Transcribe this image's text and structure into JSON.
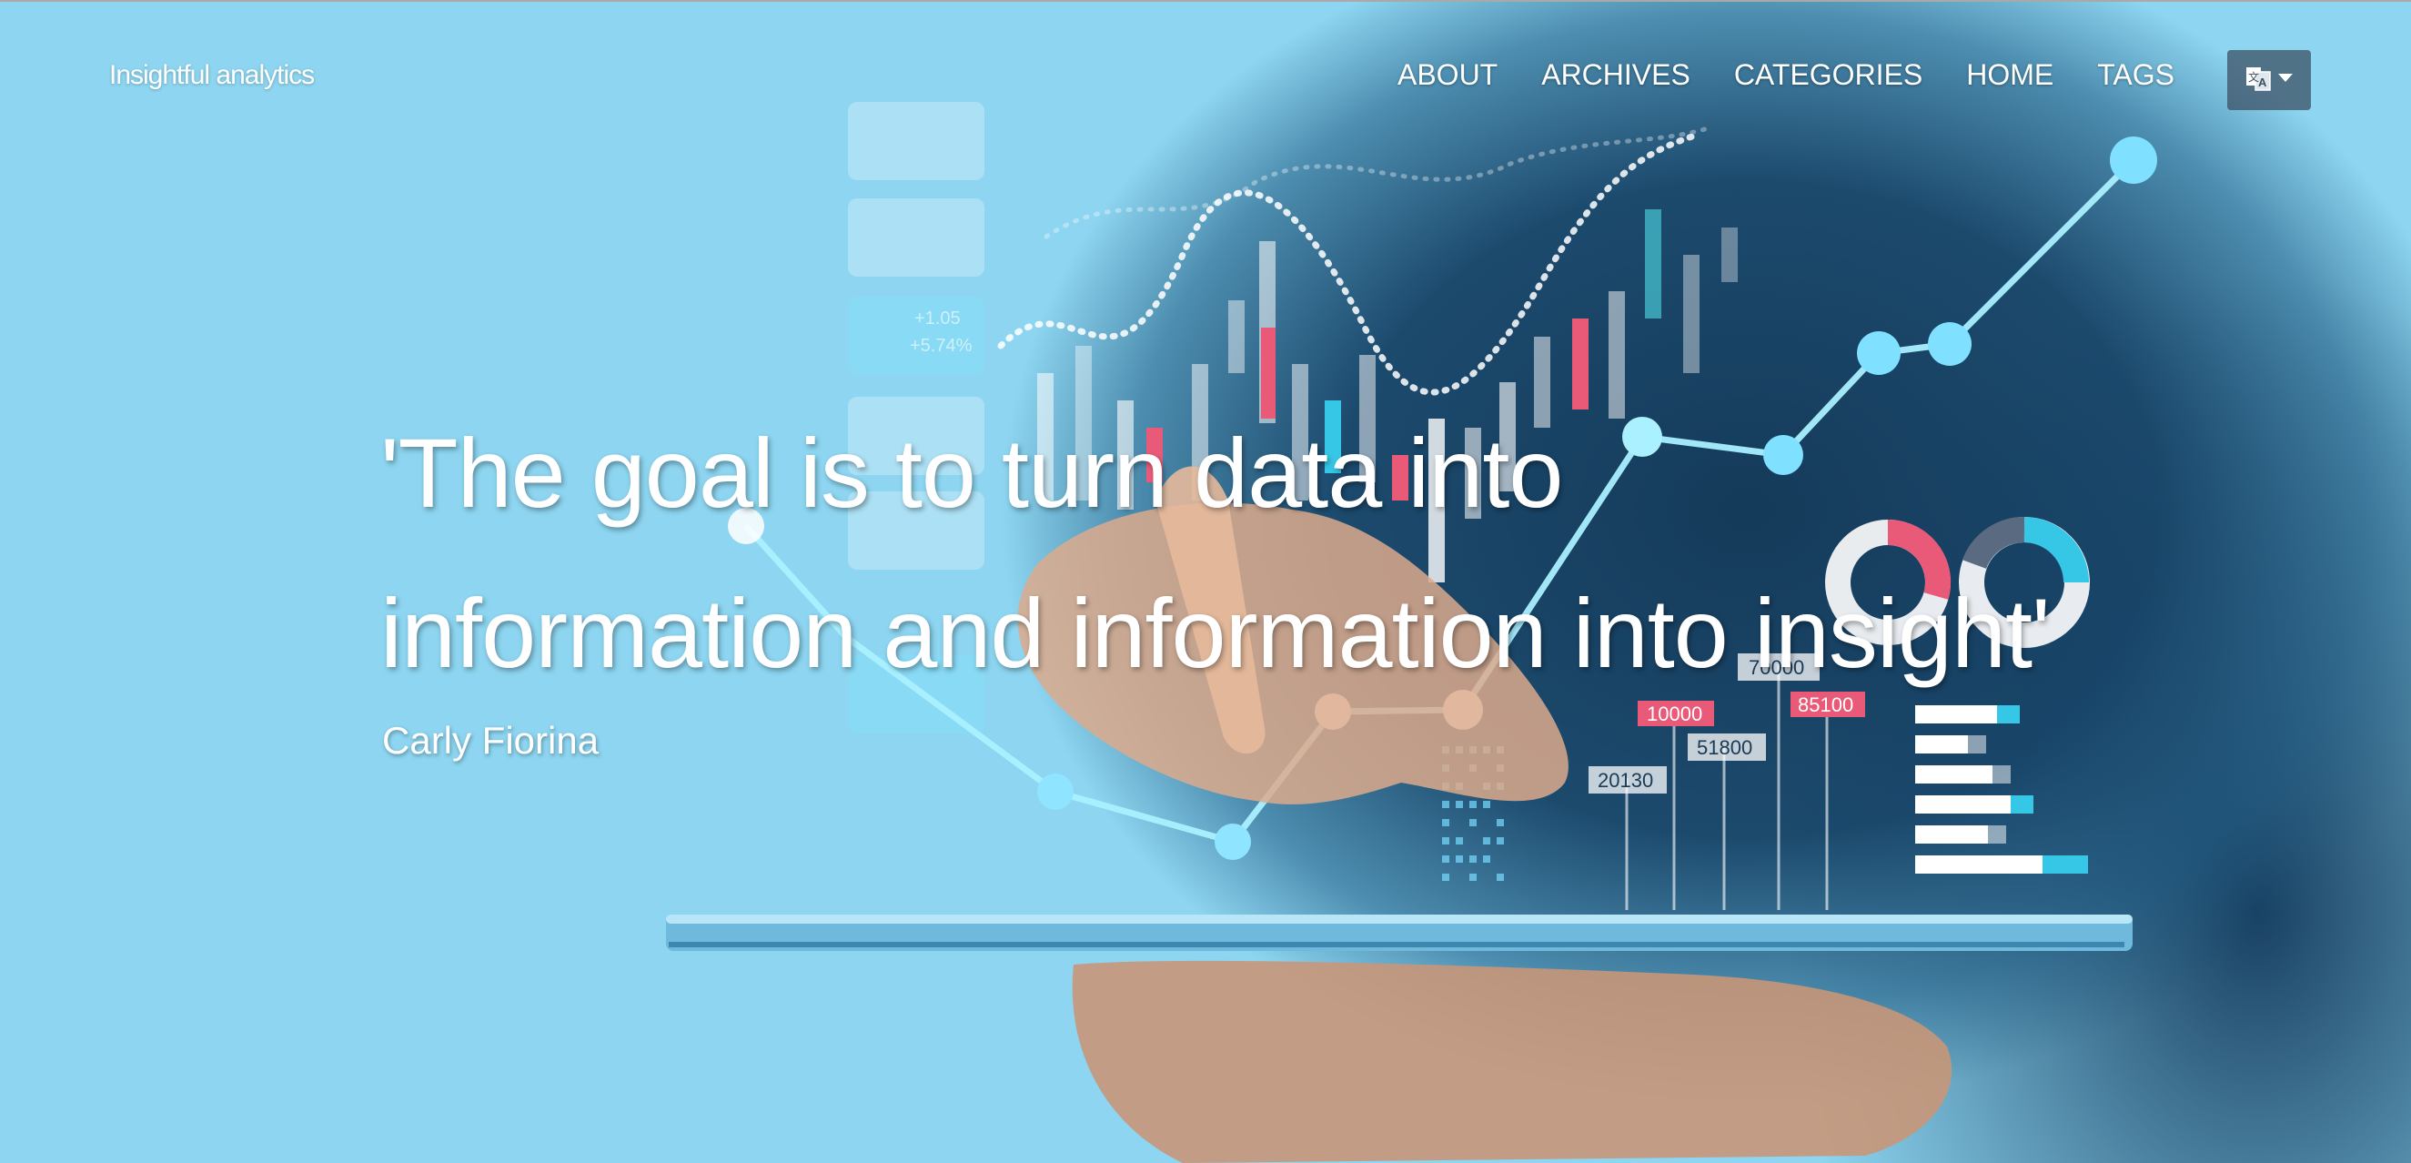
{
  "site": {
    "brand": "Insightful analytics"
  },
  "nav": {
    "items": [
      "ABOUT",
      "ARCHIVES",
      "CATEGORIES",
      "HOME",
      "TAGS"
    ],
    "language_icon": "translate-icon"
  },
  "hero": {
    "quote_line1": "'The goal is to turn data into",
    "quote_line2": "information and information into insight'",
    "author": "Carly Fiorina",
    "background_color": "#8dd5f0"
  },
  "artwork": {
    "labels": [
      "70000",
      "10000",
      "51800",
      "20130",
      "85100",
      "+1.05",
      "+5.74%"
    ]
  }
}
